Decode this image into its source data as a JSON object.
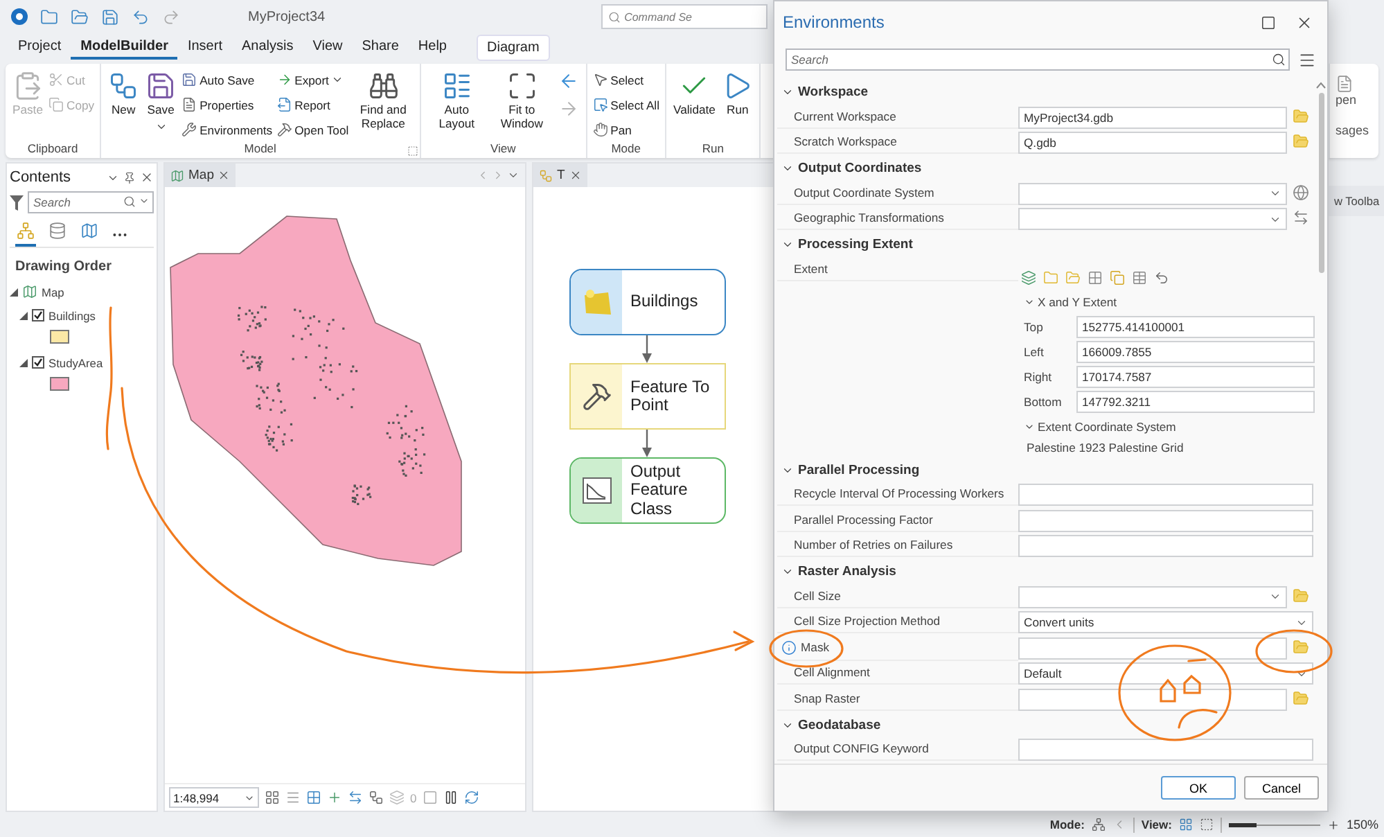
{
  "titlebar": {
    "project": "MyProject34",
    "command_search": {
      "placeholder": "Command Se"
    }
  },
  "menu_tabs": [
    {
      "label": "Project",
      "selected": false
    },
    {
      "label": "ModelBuilder",
      "selected": true
    },
    {
      "label": "Insert",
      "selected": false
    },
    {
      "label": "Analysis",
      "selected": false
    },
    {
      "label": "View",
      "selected": false
    },
    {
      "label": "Share",
      "selected": false
    },
    {
      "label": "Help",
      "selected": false
    }
  ],
  "contextual_tab": {
    "label": "Diagram"
  },
  "ribbon": {
    "groups": [
      {
        "label": "Clipboard",
        "columns": [
          {
            "kind": "large",
            "label": "Paste",
            "disabled": true
          },
          {
            "kind": "stack",
            "items": [
              {
                "label": "Cut",
                "disabled": true
              },
              {
                "label": "Copy",
                "disabled": true
              }
            ]
          }
        ]
      },
      {
        "label": "Model",
        "launcher": true,
        "columns": [
          {
            "kind": "large",
            "label": "New",
            "disabled": false
          },
          {
            "kind": "large",
            "label": "Save",
            "disabled": false,
            "menu": true
          },
          {
            "kind": "stack",
            "items": [
              {
                "label": "Auto Save",
                "disabled": false
              },
              {
                "label": "Properties",
                "disabled": false
              },
              {
                "label": "Environments",
                "disabled": false
              }
            ]
          },
          {
            "kind": "stack",
            "items": [
              {
                "label": "Export",
                "disabled": false,
                "menu": true
              },
              {
                "label": "Report",
                "disabled": false
              },
              {
                "label": "Open Tool",
                "disabled": false
              }
            ]
          },
          {
            "kind": "large",
            "label": "Find and Replace",
            "disabled": false
          }
        ]
      },
      {
        "label": "View",
        "columns": [
          {
            "kind": "large",
            "label": "Auto Layout",
            "disabled": false
          },
          {
            "kind": "large",
            "label": "Fit to Window",
            "disabled": false
          },
          {
            "kind": "nav",
            "items": [
              {
                "disabled": false
              },
              {
                "disabled": true
              }
            ]
          }
        ]
      },
      {
        "label": "Mode",
        "columns": [
          {
            "kind": "stack",
            "items": [
              {
                "label": "Select",
                "disabled": false
              },
              {
                "label": "Select All",
                "disabled": false
              },
              {
                "label": "Pan",
                "disabled": false
              }
            ]
          }
        ]
      },
      {
        "label": "Run",
        "columns": [
          {
            "kind": "large",
            "label": "Validate",
            "disabled": false
          },
          {
            "kind": "large",
            "label": "Run",
            "disabled": false
          }
        ]
      }
    ],
    "right": {
      "button_label": "pen",
      "group_label": "sages"
    }
  },
  "contents": {
    "title": "Contents",
    "search": {
      "placeholder": "Search"
    },
    "views": [
      {
        "selected": true
      },
      {
        "selected": false
      },
      {
        "selected": false
      }
    ],
    "heading": "Drawing Order",
    "tree": [
      {
        "label": "Map",
        "expanded": true,
        "children": [
          {
            "label": "Buildings",
            "checked": true,
            "expanded": true,
            "color": "#fbe8a6"
          },
          {
            "label": "StudyArea",
            "checked": true,
            "expanded": true,
            "color": "#f7a8bf"
          }
        ]
      }
    ]
  },
  "map_view": {
    "tab": {
      "label": "Map",
      "selected": true
    },
    "scale": "1:48,994",
    "selection_count": "0"
  },
  "model_view": {
    "tab": {
      "label": "T",
      "selected": true
    },
    "nodes": [
      {
        "kind": "data",
        "label": "Buildings"
      },
      {
        "kind": "tool",
        "label": "Feature To Point"
      },
      {
        "kind": "output",
        "label": "Output Feature Class"
      }
    ]
  },
  "right_pane": {
    "tab": {
      "label": "w Toolba"
    }
  },
  "dialog": {
    "title": "Environments",
    "search": {
      "placeholder": "Search"
    },
    "sections": [
      {
        "title": "Workspace",
        "expanded": true,
        "rows": [
          {
            "kind": "text",
            "label": "Current Workspace",
            "value": "MyProject34.gdb",
            "browse_button": true
          },
          {
            "kind": "text",
            "label": "Scratch Workspace",
            "value": "Q.gdb",
            "browse_button": true
          }
        ]
      },
      {
        "title": "Output Coordinates",
        "expanded": true,
        "rows": [
          {
            "kind": "dropdown",
            "label": "Output Coordinate System",
            "coordinate_button": true
          },
          {
            "kind": "dropdown",
            "label": "Geographic Transformations",
            "transform_button": true
          }
        ]
      },
      {
        "title": "Processing Extent",
        "expanded": true,
        "rows": [
          {
            "kind": "extent",
            "label": "Extent",
            "extent": {
              "header": "X and Y Extent",
              "fields": [
                {
                  "label": "Top",
                  "value": "152775.414100001"
                },
                {
                  "label": "Left",
                  "value": "166009.7855"
                },
                {
                  "label": "Right",
                  "value": "170174.7587"
                },
                {
                  "label": "Bottom",
                  "value": "147792.3211"
                }
              ],
              "coordinate_header": "Extent Coordinate System",
              "coordinate_system": "Palestine 1923 Palestine Grid"
            }
          }
        ]
      },
      {
        "title": "Parallel Processing",
        "expanded": true,
        "rows": [
          {
            "kind": "text",
            "label": "Recycle Interval Of Processing Workers"
          },
          {
            "kind": "text",
            "label": "Parallel Processing Factor"
          },
          {
            "kind": "text",
            "label": "Number of Retries on Failures"
          }
        ]
      },
      {
        "title": "Raster Analysis",
        "expanded": true,
        "rows": [
          {
            "kind": "dropdown",
            "label": "Cell Size",
            "browse_button": true
          },
          {
            "kind": "dropdown",
            "label": "Cell Size Projection Method",
            "value": "Convert units"
          },
          {
            "kind": "text",
            "label": "Mask",
            "info": true,
            "browse_button": true
          },
          {
            "kind": "dropdown",
            "label": "Cell Alignment",
            "value": "Default"
          },
          {
            "kind": "text",
            "label": "Snap Raster",
            "browse_button": true
          }
        ]
      },
      {
        "title": "Geodatabase",
        "expanded": true,
        "rows": [
          {
            "kind": "text",
            "label": "Output CONFIG Keyword"
          }
        ]
      }
    ],
    "buttons": [
      {
        "label": "OK",
        "default": true
      },
      {
        "label": "Cancel",
        "default": false
      }
    ]
  },
  "status_bar": {
    "mode_label": "Mode:",
    "view_label": "View:",
    "zoom": {
      "level": 0.3,
      "reading": "150%"
    }
  }
}
